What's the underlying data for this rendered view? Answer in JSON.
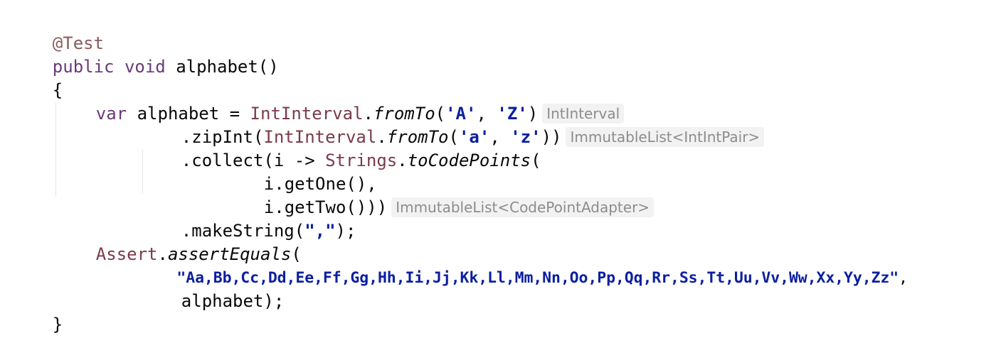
{
  "code": {
    "l1": "@Test",
    "l2a": "public void",
    "l2b": " alphabet()",
    "l3": "{",
    "l4a": "var",
    "l4b": " alphabet = ",
    "l4c": "IntInterval",
    "l4d": ".",
    "l4e": "fromTo",
    "l4f": "(",
    "l4g": "'A'",
    "l4h": ", ",
    "l4i": "'Z'",
    "l4j": ")",
    "l5a": ".zipInt(",
    "l5b": "IntInterval",
    "l5c": ".",
    "l5d": "fromTo",
    "l5e": "(",
    "l5f": "'a'",
    "l5g": ", ",
    "l5h": "'z'",
    "l5i": "))",
    "l6a": ".collect(i -> ",
    "l6b": "Strings",
    "l6c": ".",
    "l6d": "toCodePoints",
    "l6e": "(",
    "l7": "i.getOne(),",
    "l8": "i.getTwo()))",
    "l9a": ".makeString(",
    "l9b": "\",\"",
    "l9c": ");",
    "l10a": "Assert",
    "l10b": ".",
    "l10c": "assertEquals",
    "l10d": "(",
    "l11a": "\"Aa,Bb,Cc,Dd,Ee,Ff,Gg,Hh,Ii,Jj,Kk,Ll,Mm,Nn,Oo,Pp,Qq,Rr,Ss,Tt,Uu,Vv,Ww,Xx,Yy,Zz\"",
    "l11b": ",",
    "l12": "alphabet);",
    "l13": "}"
  },
  "hints": {
    "h1": "IntInterval",
    "h2": "ImmutableList<IntIntPair>",
    "h3": "ImmutableList<CodePointAdapter>"
  },
  "colors": {
    "annotation": "#8a5a5a",
    "keyword": "#6a3a7a",
    "class": "#7a3b4a",
    "string": "#0b1fa0",
    "hint_text": "#8c8c8c",
    "hint_bg": "#f2f2f2"
  }
}
